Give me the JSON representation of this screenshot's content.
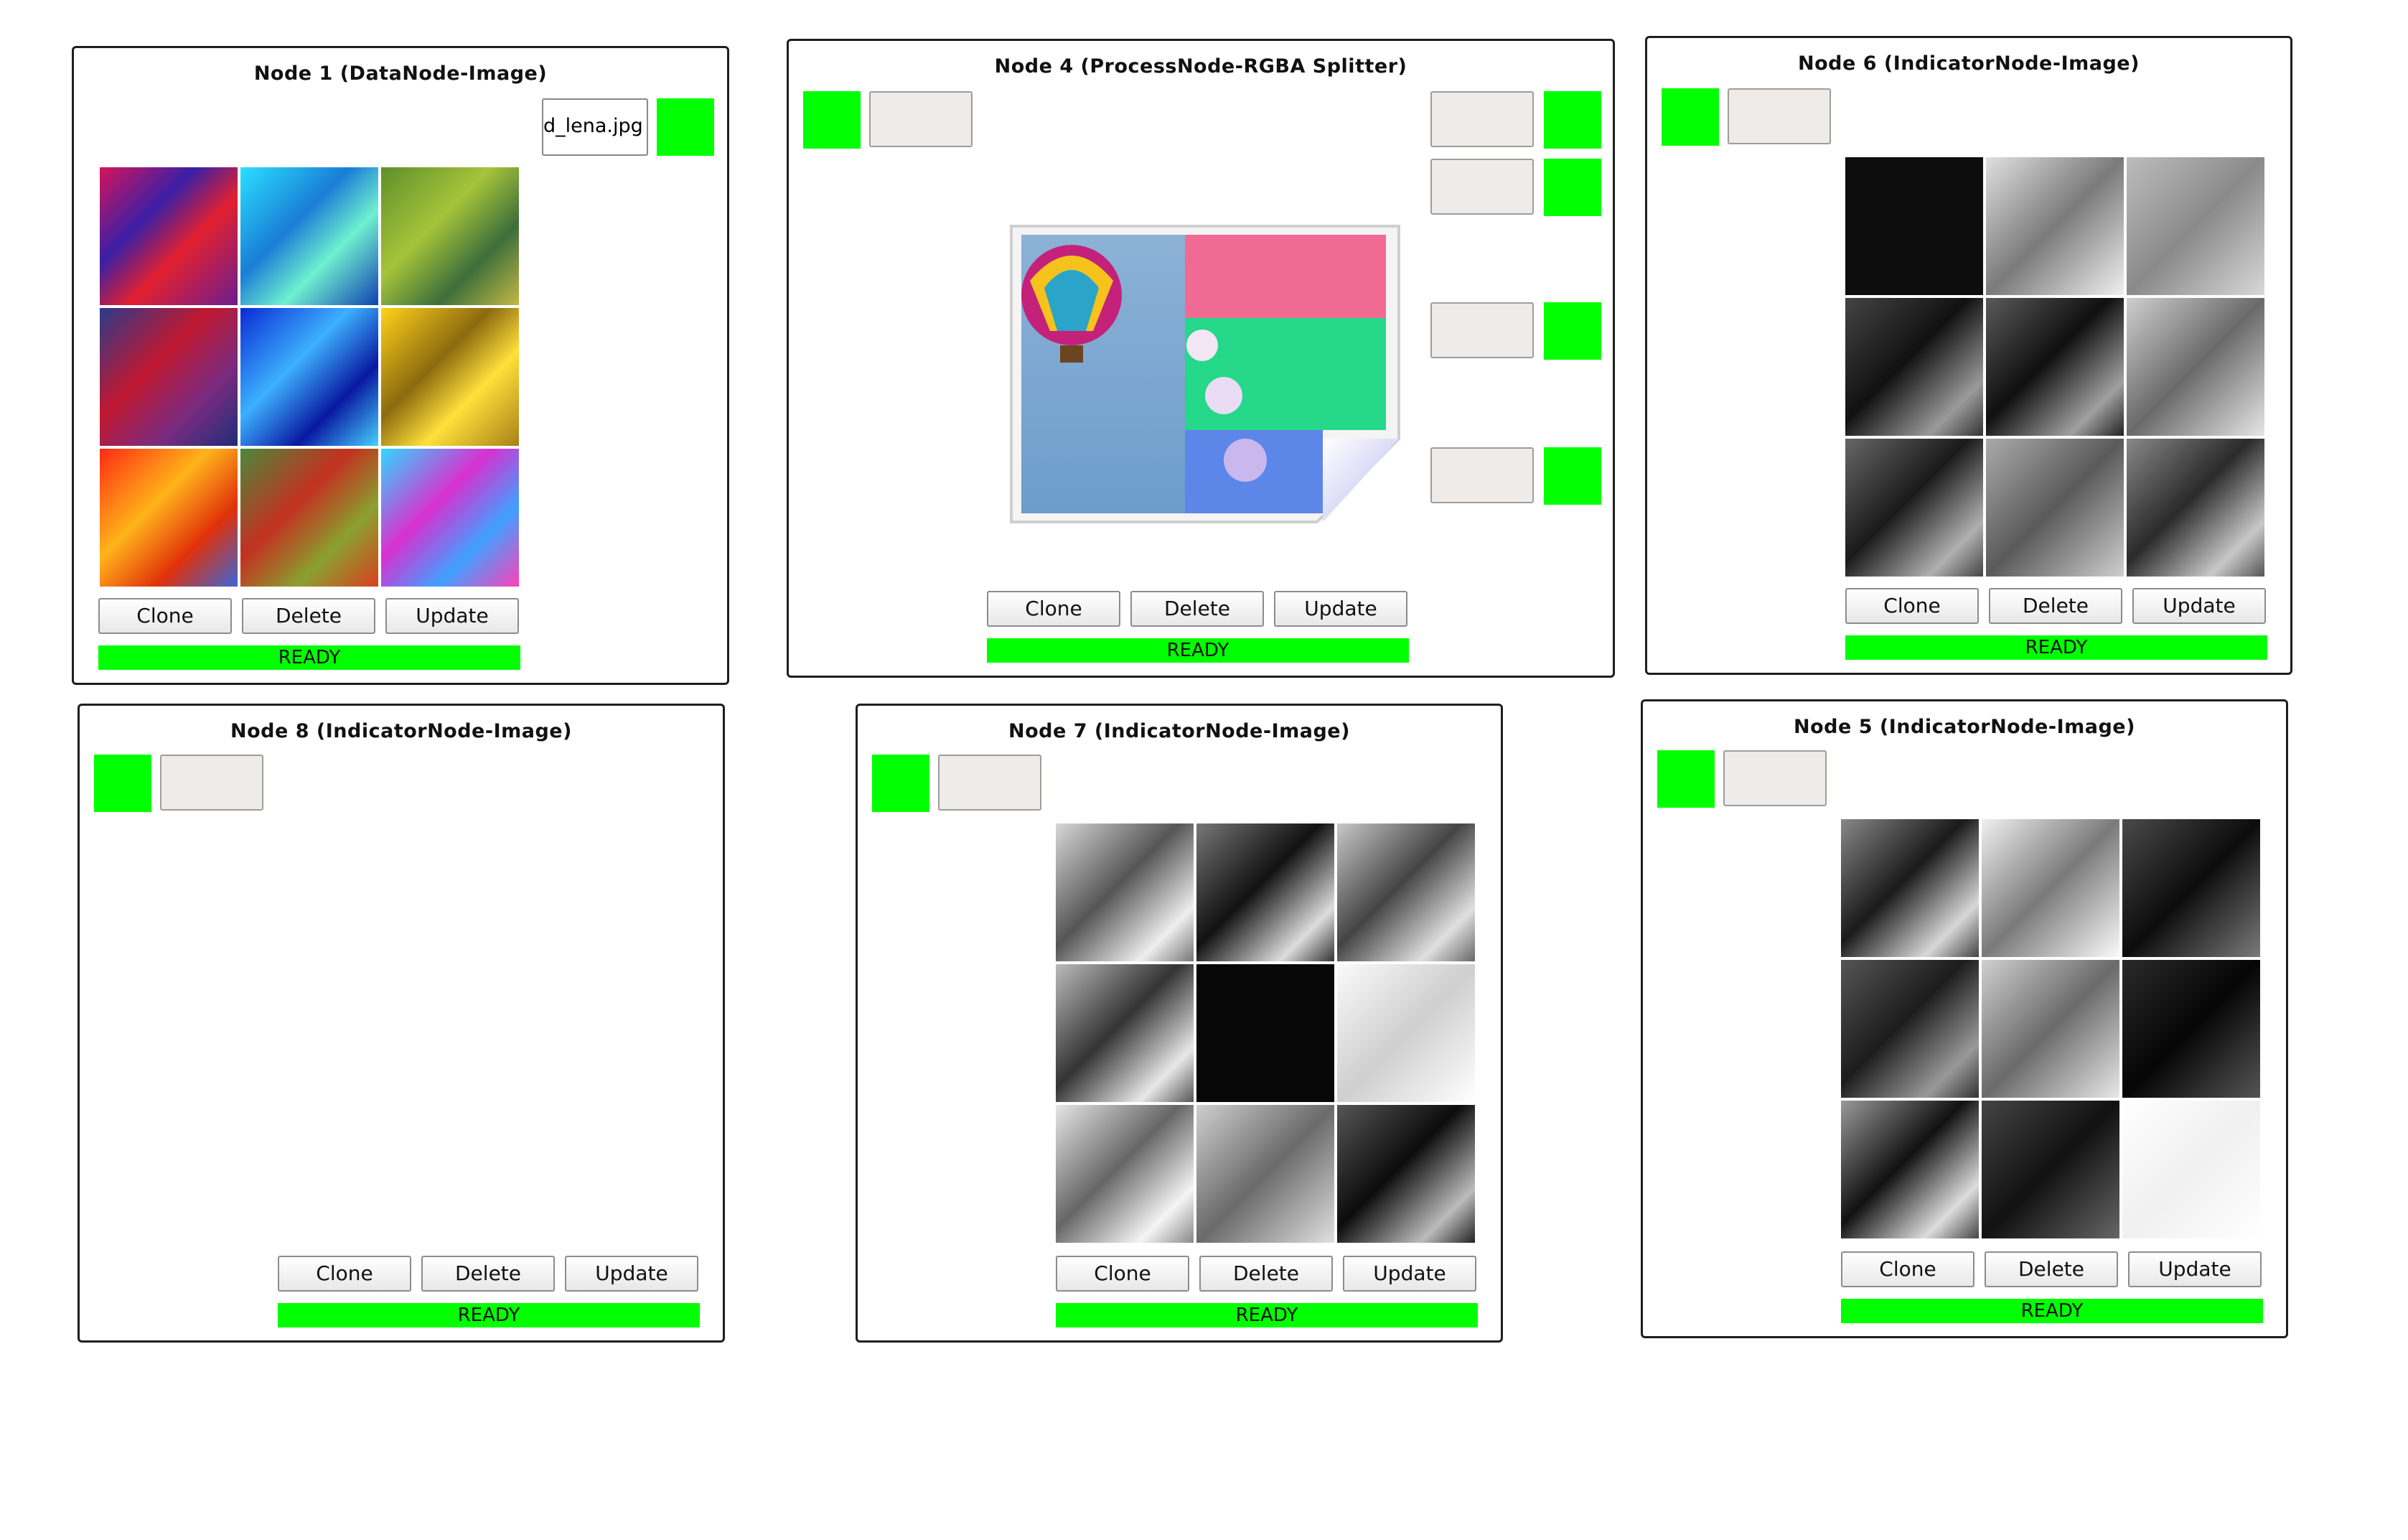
{
  "nodes": {
    "node1": {
      "title": "Node 1 (DataNode-Image)",
      "filename": "d_lena.jpg",
      "clone": "Clone",
      "delete": "Delete",
      "update": "Update",
      "status": "READY"
    },
    "node4": {
      "title": "Node 4 (ProcessNode-RGBA Splitter)",
      "clone": "Clone",
      "delete": "Delete",
      "update": "Update",
      "status": "READY"
    },
    "node6": {
      "title": "Node 6 (IndicatorNode-Image)",
      "clone": "Clone",
      "delete": "Delete",
      "update": "Update",
      "status": "READY"
    },
    "node8": {
      "title": "Node 8 (IndicatorNode-Image)",
      "clone": "Clone",
      "delete": "Delete",
      "update": "Update",
      "status": "READY"
    },
    "node7": {
      "title": "Node 7 (IndicatorNode-Image)",
      "clone": "Clone",
      "delete": "Delete",
      "update": "Update",
      "status": "READY"
    },
    "node5": {
      "title": "Node 5 (IndicatorNode-Image)",
      "clone": "Clone",
      "delete": "Delete",
      "update": "Update",
      "status": "READY"
    }
  },
  "colors": {
    "port_active": "#00ff00",
    "status_ready": "#00ff00",
    "port_idle": "#eeece9"
  },
  "icons": {
    "node4_preview": "image-file-icon"
  }
}
